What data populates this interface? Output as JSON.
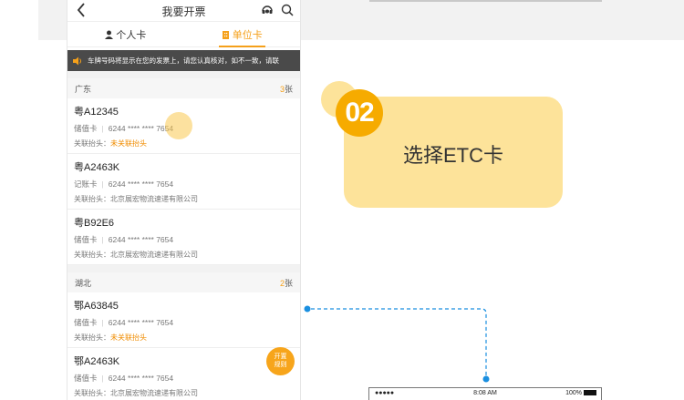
{
  "nav": {
    "title": "我要开票"
  },
  "tabs": [
    {
      "label": "个人卡"
    },
    {
      "label": "单位卡"
    }
  ],
  "notice": {
    "text": "车牌号码将显示在您的发票上，请您认真核对，如不一致，请联"
  },
  "groups": [
    {
      "name": "广东",
      "count": "3",
      "count_unit": "张",
      "items": [
        {
          "plate": "粤A12345",
          "type": "储值卡",
          "number": "6244 **** **** 7654",
          "title_label": "关联抬头：",
          "title_value": "未关联抬头",
          "unlinked": true
        },
        {
          "plate": "粤A2463K",
          "type": "记账卡",
          "number": "6244 **** **** 7654",
          "title_label": "关联抬头：",
          "title_value": "北京展宏物流速递有限公司",
          "unlinked": false
        },
        {
          "plate": "粤B92E6",
          "type": "储值卡",
          "number": "6244 **** **** 7654",
          "title_label": "关联抬头：",
          "title_value": "北京展宏物流速递有限公司",
          "unlinked": false
        }
      ]
    },
    {
      "name": "湖北",
      "count": "2",
      "count_unit": "张",
      "items": [
        {
          "plate": "鄂A63845",
          "type": "储值卡",
          "number": "6244 **** **** 7654",
          "title_label": "关联抬头：",
          "title_value": "未关联抬头",
          "unlinked": true
        },
        {
          "plate": "鄂A2463K",
          "type": "储值卡",
          "number": "6244 **** **** 7654",
          "title_label": "关联抬头：",
          "title_value": "北京展宏物流速递有限公司",
          "unlinked": false
        }
      ]
    }
  ],
  "fab": {
    "line1": "开置",
    "line2": "规则"
  },
  "step": {
    "number": "02",
    "label": "选择ETC卡"
  },
  "status_bar": {
    "signal": "●●●●●",
    "time": "8:08 AM",
    "battery": "100%"
  },
  "colors": {
    "accent": "#f5a01a",
    "step_bg": "#fde39a",
    "step_circle": "#f6ab00",
    "connector": "#1a8fe0"
  }
}
